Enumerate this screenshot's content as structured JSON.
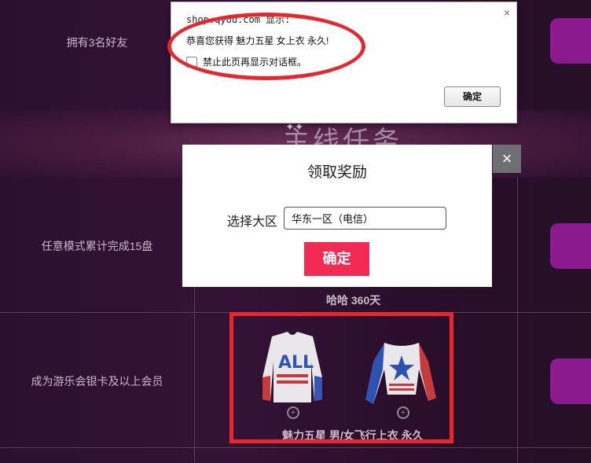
{
  "rows": [
    {
      "label": "拥有3名好友"
    },
    {
      "label": "任意模式累计完成15盘"
    },
    {
      "label": "成为游乐会银卡及以上会员"
    }
  ],
  "banner": {
    "title": "主线任务"
  },
  "prizes": {
    "row2_text": "哈哈 360天",
    "row3_text": "魅力五星 男/女飞行上衣 永久"
  },
  "alert": {
    "title": "shop.qyou.com 显示:",
    "message": "恭喜您获得 魅力五星 女上衣 永久!",
    "checkbox_label": "禁止此页再显示对话框。",
    "ok_label": "确定",
    "close_glyph": "×"
  },
  "modal": {
    "title": "领取奖励",
    "select_label": "选择大区",
    "select_value": "华东一区（电信）",
    "confirm_label": "确定",
    "close_glyph": "×"
  },
  "colors": {
    "background": "#2b0f28",
    "accent_red": "#e8262c",
    "confirm_pink": "#f22a54",
    "purple_button": "#8a1a8e"
  }
}
